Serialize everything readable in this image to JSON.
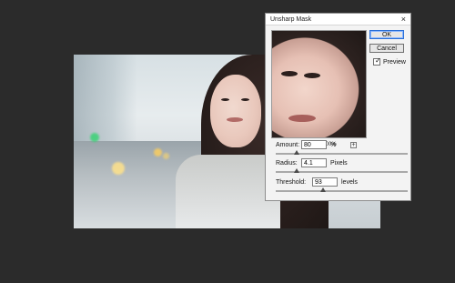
{
  "dialog": {
    "title": "Unsharp Mask",
    "buttons": {
      "ok": "OK",
      "cancel": "Cancel"
    },
    "preview": {
      "label": "Preview",
      "checked": true
    },
    "zoom": {
      "minus": "−",
      "value": "100%",
      "plus": "+"
    },
    "params": {
      "amount": {
        "label": "Amount:",
        "value": "80",
        "unit": "%",
        "slider_fraction": 0.16
      },
      "radius": {
        "label": "Radius:",
        "value": "4.1",
        "unit": "Pixels",
        "slider_fraction": 0.16
      },
      "threshold": {
        "label": "Threshold:",
        "value": "93",
        "unit": "levels",
        "slider_fraction": 0.36
      }
    }
  }
}
